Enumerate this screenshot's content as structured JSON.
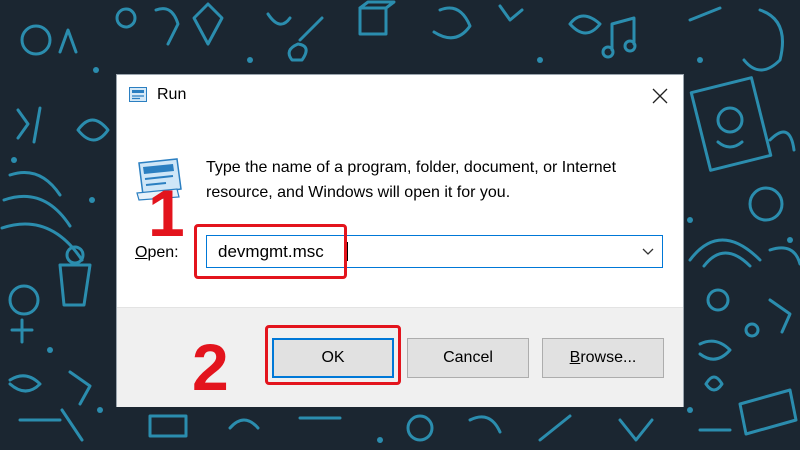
{
  "wallpaper": {
    "color": "#1b2631",
    "doodle_color": "#2e9fc4"
  },
  "dialog": {
    "title": "Run",
    "description": "Type the name of a program, folder, document, or Internet resource, and Windows will open it for you.",
    "open_label_accel": "O",
    "open_label_rest": "pen:",
    "command_value": "devmgmt.msc",
    "buttons": {
      "ok": "OK",
      "cancel": "Cancel",
      "browse_accel": "B",
      "browse_rest": "rowse..."
    }
  },
  "annotations": {
    "step1": "1",
    "step2": "2",
    "highlight_color": "#e3141d"
  },
  "icons": [
    "run-app-icon",
    "close-icon",
    "chevron-down-icon"
  ]
}
